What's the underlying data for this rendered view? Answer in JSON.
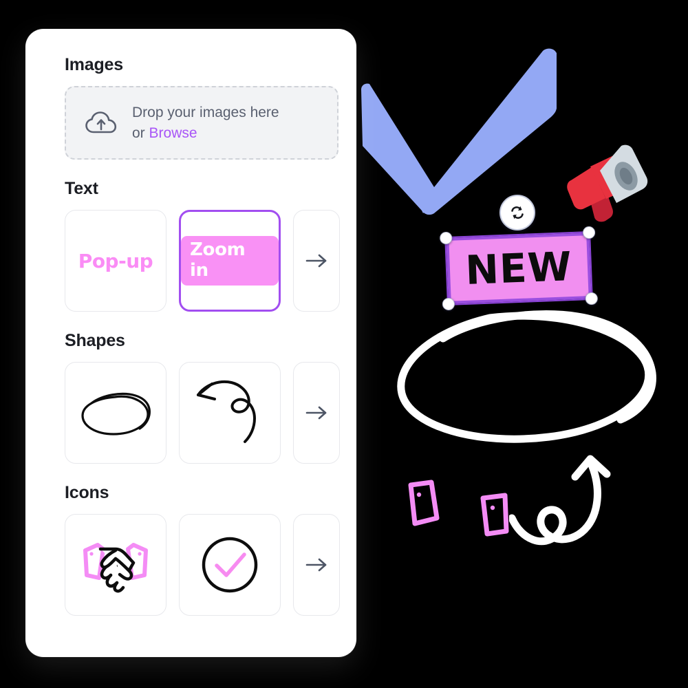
{
  "app": {
    "background_color": "#000000",
    "panel_background": "#ffffff",
    "accent_purple": "#a855f7",
    "accent_pink": "#fa8cf5",
    "selected_border": "#a24ef0"
  },
  "panel": {
    "sections": [
      {
        "id": "images",
        "title": "Images",
        "dropzone": {
          "icon": "cloud-upload-icon",
          "line1": "Drop your images here",
          "line2_prefix": "or ",
          "line2_link": "Browse"
        }
      },
      {
        "id": "text",
        "title": "Text",
        "cards": [
          {
            "id": "pop-up",
            "label": "Pop-up",
            "style": "pink-text",
            "selected": false
          },
          {
            "id": "zoom-in",
            "label": "Zoom in",
            "style": "pink-pill",
            "selected": true
          }
        ],
        "more_label": "→"
      },
      {
        "id": "shapes",
        "title": "Shapes",
        "cards": [
          {
            "id": "ellipse-scribble",
            "icon": "hand-drawn-ellipse-icon",
            "selected": false
          },
          {
            "id": "curved-loop-arrow",
            "icon": "curved-loop-arrow-icon",
            "selected": false
          }
        ],
        "more_label": "→"
      },
      {
        "id": "icons",
        "title": "Icons",
        "cards": [
          {
            "id": "handshake",
            "icon": "handshake-icon",
            "selected": false
          },
          {
            "id": "check-circle",
            "icon": "circle-check-icon",
            "selected": false
          }
        ],
        "more_label": "→"
      }
    ]
  },
  "canvas": {
    "elements": [
      {
        "id": "blue-checkmark",
        "name": "blue-checkmark-shape",
        "color": "#93a8f4"
      },
      {
        "id": "megaphone",
        "name": "megaphone-emoji",
        "color": "#e8323f"
      },
      {
        "id": "new-badge",
        "name": "new-text-badge",
        "label": "NEW",
        "fill": "#f18ff0",
        "border": "#9b4fe0",
        "selected": true
      },
      {
        "id": "rotate-handle",
        "name": "rotate-icon",
        "color": "#1c1e24"
      },
      {
        "id": "white-ellipse",
        "name": "hand-drawn-ellipse-annotation",
        "color": "#ffffff"
      },
      {
        "id": "loop-arrow",
        "name": "curved-loop-arrow-annotation",
        "color": "#ffffff"
      },
      {
        "id": "cuff-left",
        "name": "pink-cuff-shape",
        "color": "#f48cf5"
      },
      {
        "id": "cuff-right",
        "name": "pink-cuff-shape",
        "color": "#f48cf5"
      }
    ]
  }
}
